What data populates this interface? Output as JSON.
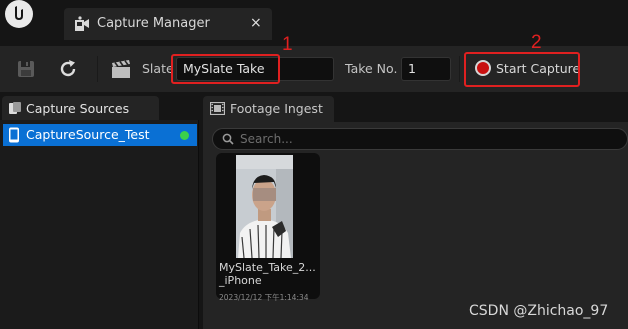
{
  "window": {
    "tab_title": "Capture Manager",
    "close_glyph": "×"
  },
  "toolbar": {
    "save_icon": "save-icon",
    "refresh_icon": "refresh-icon",
    "clapper_icon": "clapperboard-icon",
    "slate_label": "Slate",
    "slate_value": "MySlate Take",
    "take_label": "Take No.",
    "take_value": "1",
    "start_capture_label": "Start Capture"
  },
  "annotations": {
    "marker_1": "1",
    "marker_2": "2",
    "highlight_color": "#e02020"
  },
  "capture_sources": {
    "tab_title": "Capture Sources",
    "items": [
      {
        "label": "CaptureSource_Test",
        "status_color": "#3bd14b",
        "selected": true
      }
    ]
  },
  "footage_ingest": {
    "tab_title": "Footage Ingest",
    "search_placeholder": "Search...",
    "takes": [
      {
        "name": "MySlate_Take_2..._iPhone",
        "date": "2023/12/12 下午1:14:34"
      }
    ]
  },
  "watermark": "CSDN @Zhichao_97",
  "colors": {
    "selection": "#0a70d4",
    "record": "#c81010"
  }
}
